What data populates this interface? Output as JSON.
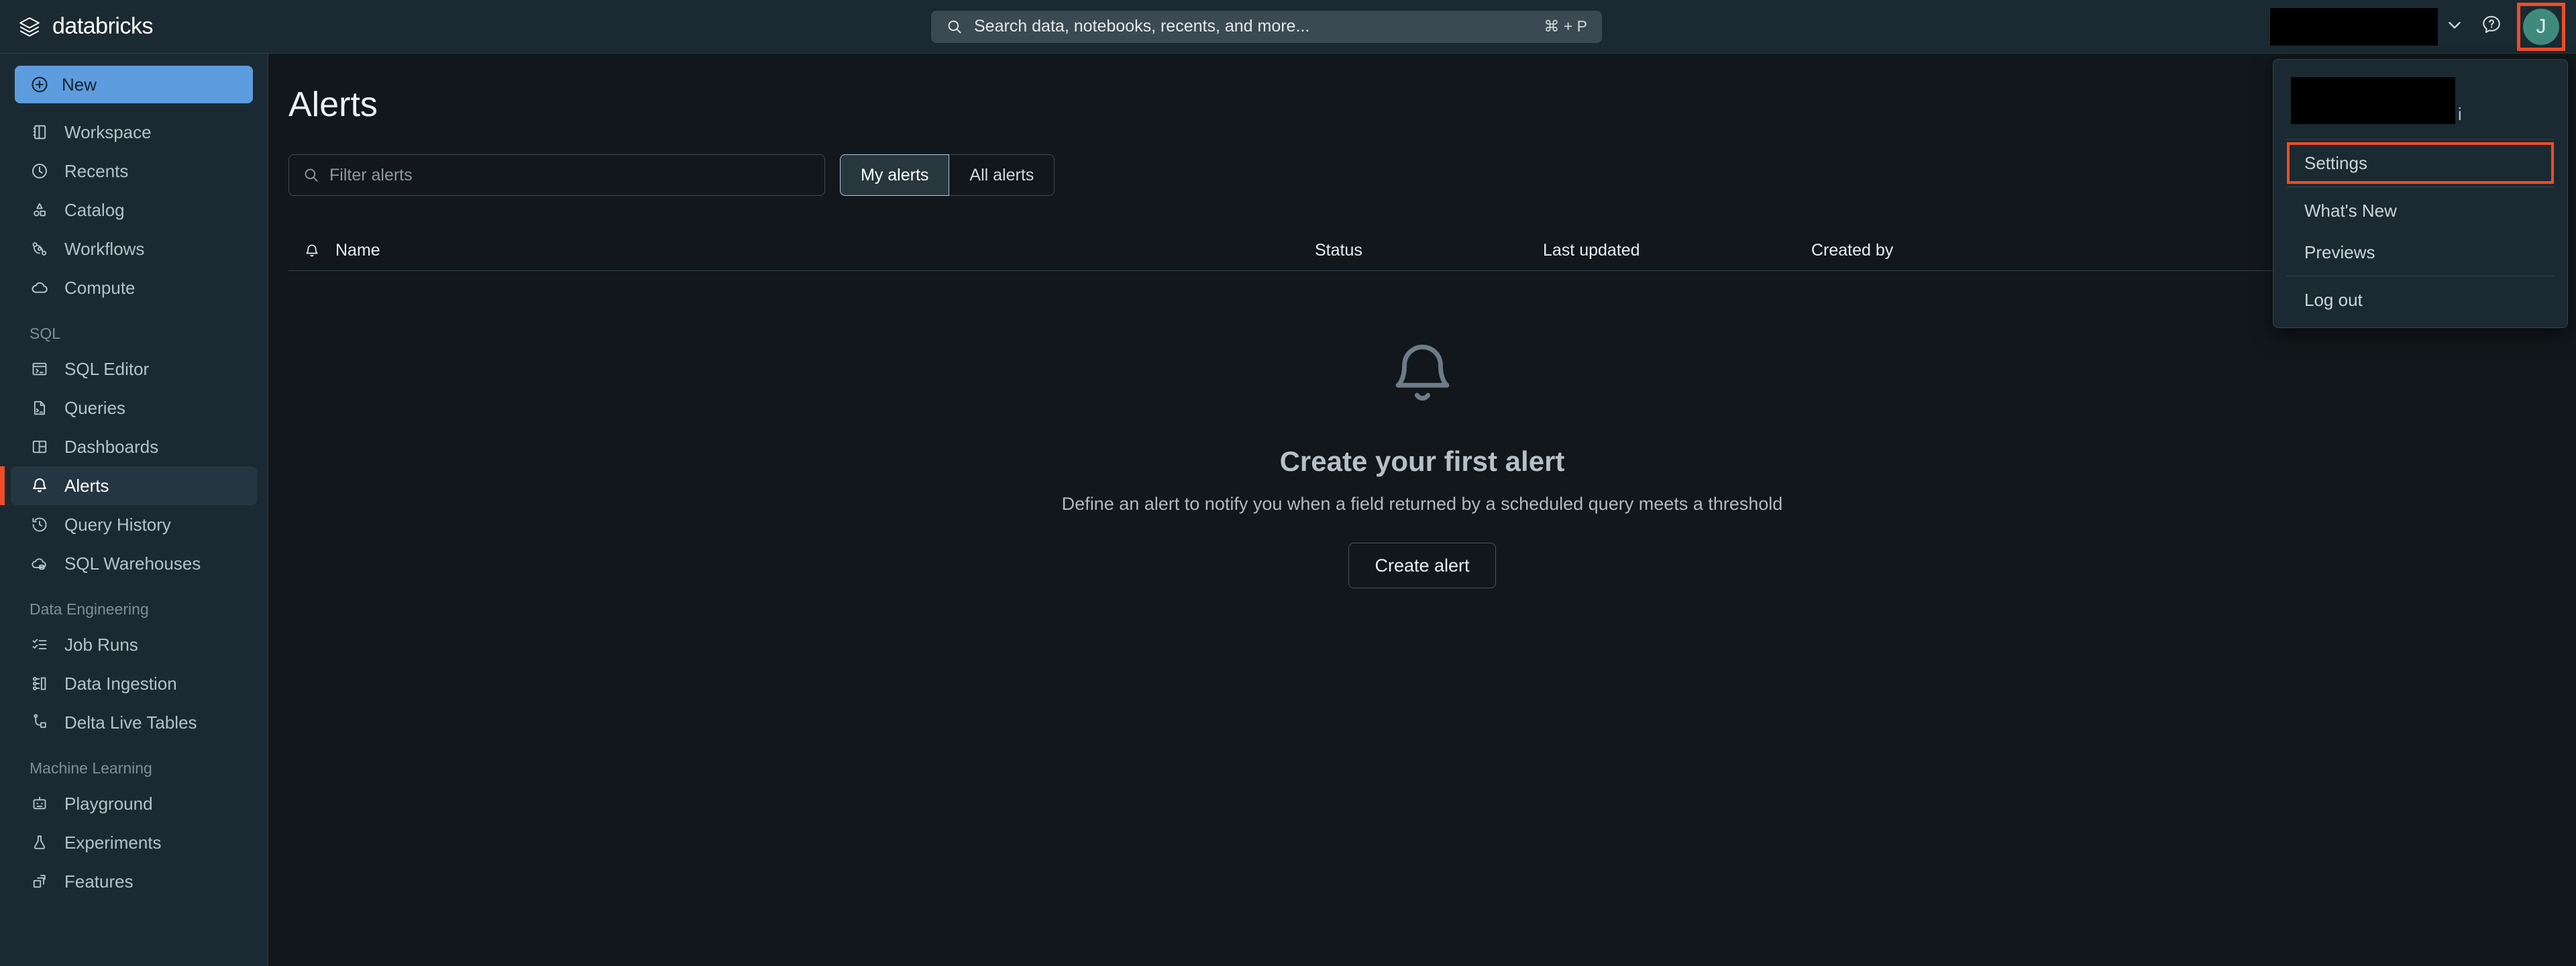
{
  "brand": {
    "name": "databricks",
    "logo_icon": "databricks-logo-icon"
  },
  "search": {
    "placeholder": "Search data, notebooks, recents, and more...",
    "shortcut": "⌘ + P",
    "icon": "search-icon"
  },
  "topbar": {
    "workspace_redacted": "",
    "chevron_icon": "chevron-down-icon",
    "help_icon": "help-circle-icon",
    "avatar_initial": "J",
    "avatar_color": "#3f8a7d",
    "highlight_color": "#f04c27"
  },
  "sidebar": {
    "new_label": "New",
    "new_icon": "plus-circle-icon",
    "new_color": "#5d9cdf",
    "primary_items": [
      {
        "label": "Workspace",
        "icon": "workspace-icon"
      },
      {
        "label": "Recents",
        "icon": "clock-icon"
      },
      {
        "label": "Catalog",
        "icon": "catalog-shapes-icon"
      },
      {
        "label": "Workflows",
        "icon": "workflows-icon"
      },
      {
        "label": "Compute",
        "icon": "cloud-icon"
      }
    ],
    "groups": [
      {
        "label": "SQL",
        "items": [
          {
            "label": "SQL Editor",
            "icon": "sql-editor-icon",
            "active": false
          },
          {
            "label": "Queries",
            "icon": "query-file-icon",
            "active": false
          },
          {
            "label": "Dashboards",
            "icon": "dashboard-grid-icon",
            "active": false
          },
          {
            "label": "Alerts",
            "icon": "bell-icon",
            "active": true
          },
          {
            "label": "Query History",
            "icon": "history-clock-icon",
            "active": false
          },
          {
            "label": "SQL Warehouses",
            "icon": "warehouse-cloud-icon",
            "active": false
          }
        ]
      },
      {
        "label": "Data Engineering",
        "items": [
          {
            "label": "Job Runs",
            "icon": "checklist-icon",
            "active": false
          },
          {
            "label": "Data Ingestion",
            "icon": "data-ingestion-icon",
            "active": false
          },
          {
            "label": "Delta Live Tables",
            "icon": "delta-live-tables-icon",
            "active": false
          }
        ]
      },
      {
        "label": "Machine Learning",
        "items": [
          {
            "label": "Playground",
            "icon": "robot-icon",
            "active": false
          },
          {
            "label": "Experiments",
            "icon": "flask-icon",
            "active": false
          },
          {
            "label": "Features",
            "icon": "features-stack-icon",
            "active": false
          }
        ]
      }
    ]
  },
  "main": {
    "title": "Alerts",
    "filter": {
      "placeholder": "Filter alerts",
      "icon": "search-icon",
      "value": ""
    },
    "segmented": [
      {
        "label": "My alerts",
        "selected": true
      },
      {
        "label": "All alerts",
        "selected": false
      }
    ],
    "table": {
      "bell_icon": "bell-icon",
      "columns": [
        "Name",
        "Status",
        "Last updated",
        "Created by"
      ],
      "rows": []
    },
    "empty_state": {
      "icon": "bell-icon",
      "title": "Create your first alert",
      "subtitle": "Define an alert to notify you when a field returned by a scheduled query meets a threshold",
      "button_label": "Create alert"
    }
  },
  "user_menu": {
    "account_redacted": "",
    "account_tail": "i",
    "items": [
      {
        "label": "Settings",
        "highlighted": true
      },
      {
        "label": "What's New",
        "highlighted": false
      },
      {
        "label": "Previews",
        "highlighted": false
      },
      {
        "label": "Log out",
        "highlighted": false
      }
    ]
  }
}
